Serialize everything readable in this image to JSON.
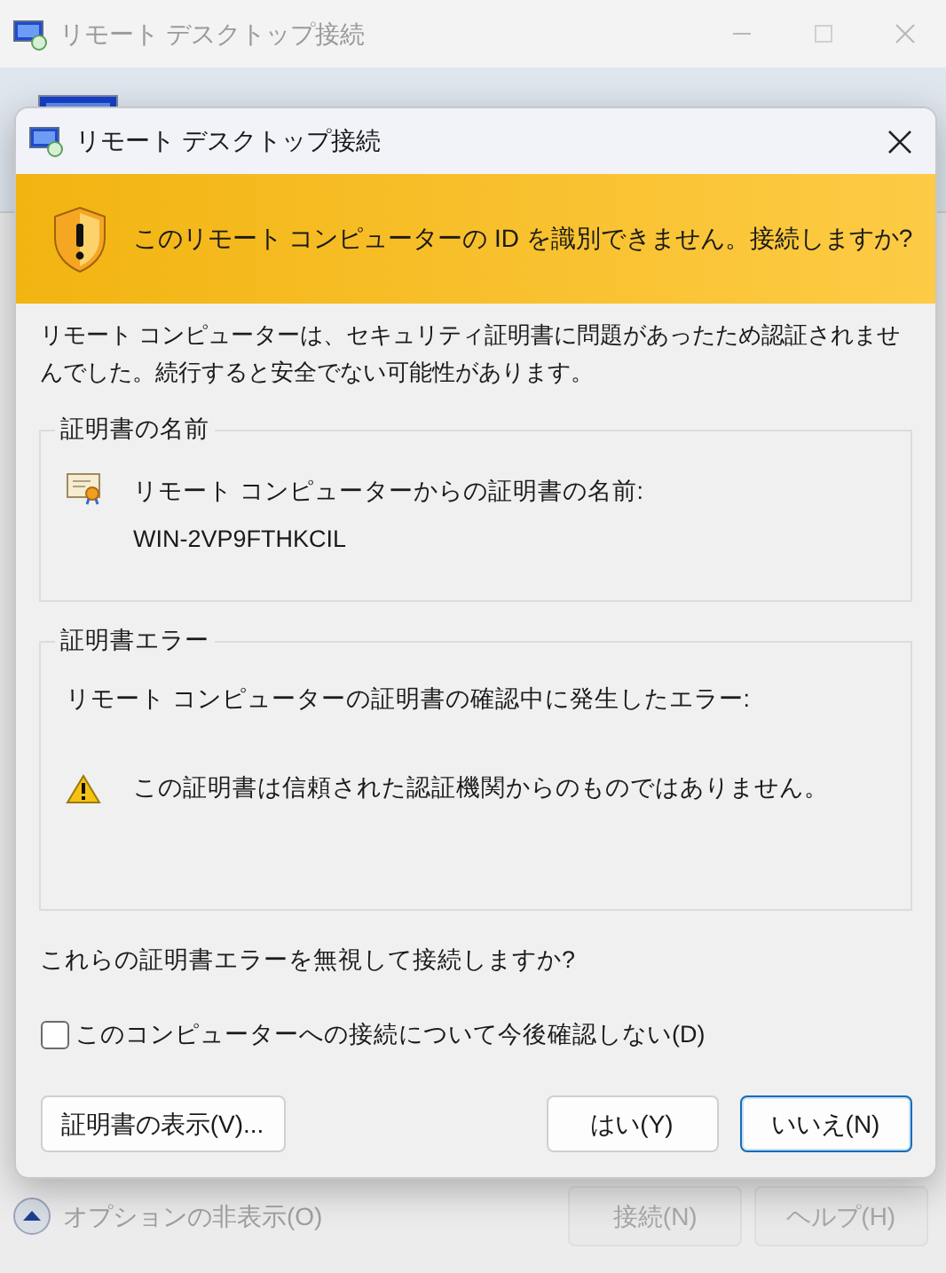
{
  "background_window": {
    "title": "リモート デスクトップ接続",
    "footer": {
      "options_toggle": "オプションの非表示(O)",
      "buttons": [
        {
          "label": "接続(N)",
          "disabled": true
        },
        {
          "label": "ヘルプ(H)",
          "disabled": true
        }
      ]
    }
  },
  "dialog": {
    "title": "リモート デスクトップ接続",
    "banner": "このリモート コンピューターの ID を識別できません。接続しますか?",
    "message": "リモート コンピューターは、セキュリティ証明書に問題があったため認証されませんでした。続行すると安全でない可能性があります。",
    "groups": [
      {
        "kind": "certificate",
        "title": "証明書の名前",
        "lines": [
          "リモート コンピューターからの証明書の名前:",
          "WIN-2VP9FTHKCIL"
        ]
      },
      {
        "kind": "errors",
        "title": "証明書エラー",
        "intro": "リモート コンピューターの証明書の確認中に発生したエラー:",
        "errors": [
          "この証明書は信頼された認証機関からのものではありません。"
        ]
      }
    ],
    "question": "これらの証明書エラーを無視して接続しますか?",
    "checkbox": {
      "label": "このコンピューターへの接続について今後確認しない(D)",
      "checked": false
    },
    "buttons": [
      {
        "label": "証明書の表示(V)...",
        "default": false
      },
      {
        "label": "はい(Y)",
        "default": false
      },
      {
        "label": "いいえ(N)",
        "default": true
      }
    ]
  }
}
